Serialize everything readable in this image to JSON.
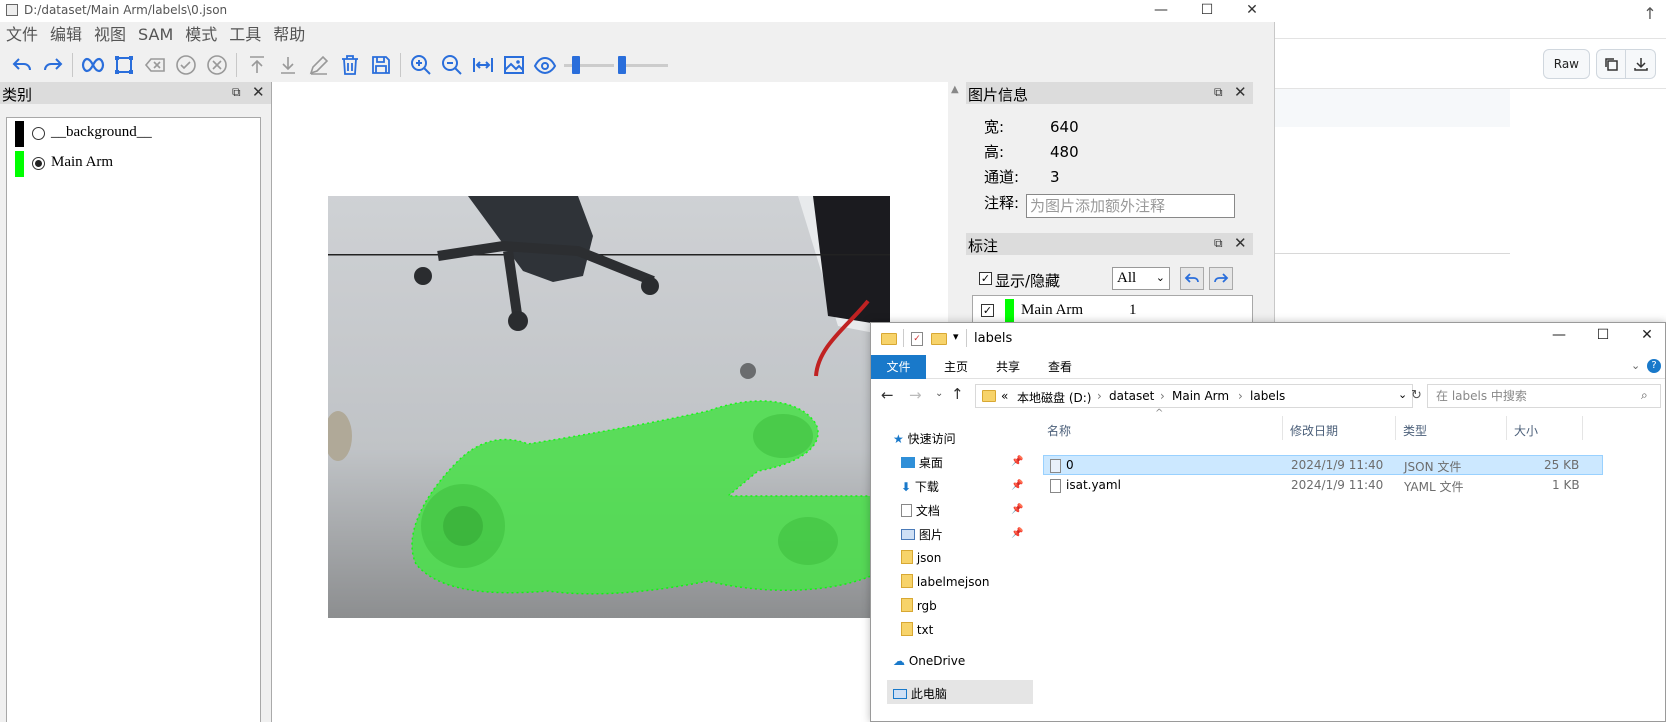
{
  "isat": {
    "title": "D:/dataset/Main Arm/labels\\0.json",
    "window_controls": [
      "—",
      "☐",
      "✕"
    ],
    "menu": [
      "文件",
      "编辑",
      "视图",
      "SAM",
      "模式",
      "工具",
      "帮助"
    ],
    "category_dock": {
      "title": "类别",
      "items": [
        {
          "label": "__background__",
          "color": "#000000",
          "selected": false
        },
        {
          "label": "Main Arm",
          "color": "#00ff00",
          "selected": true
        }
      ]
    },
    "image_info_dock": {
      "title": "图片信息",
      "width_label": "宽:",
      "width_value": "640",
      "height_label": "高:",
      "height_value": "480",
      "channel_label": "通道:",
      "channel_value": "3",
      "note_label": "注释:",
      "note_placeholder": "为图片添加额外注释"
    },
    "annotation_dock": {
      "title": "标注",
      "show_hide_label": "显示/隐藏",
      "filter_value": "All",
      "rows": [
        {
          "label": "Main Arm",
          "color": "#00ff00",
          "group": "1",
          "checked": true
        }
      ]
    },
    "accent_color": "#2a6edb",
    "mask_color": "#4ce04c"
  },
  "explorer": {
    "title": "labels",
    "window_controls": [
      "—",
      "☐",
      "✕"
    ],
    "ribbon_tabs": [
      "文件",
      "主页",
      "共享",
      "查看"
    ],
    "breadcrumb": [
      "«",
      "本地磁盘 (D:)",
      "dataset",
      "Main Arm",
      "labels"
    ],
    "search_placeholder": "在 labels 中搜索",
    "nav_items": {
      "quick_access": "快速访问",
      "desktop": "桌面",
      "downloads": "下载",
      "documents": "文档",
      "pictures": "图片",
      "json": "json",
      "labelmejson": "labelmejson",
      "rgb": "rgb",
      "txt": "txt",
      "onedrive": "OneDrive",
      "this_pc": "此电脑"
    },
    "columns": [
      "名称",
      "修改日期",
      "类型",
      "大小"
    ],
    "files": [
      {
        "name": "0",
        "modified": "2024/1/9 11:40",
        "type": "JSON 文件",
        "size": "25 KB",
        "selected": true
      },
      {
        "name": "isat.yaml",
        "modified": "2024/1/9 11:40",
        "type": "YAML 文件",
        "size": "1 KB",
        "selected": false
      }
    ]
  },
  "background_page": {
    "raw_label": "Raw"
  }
}
